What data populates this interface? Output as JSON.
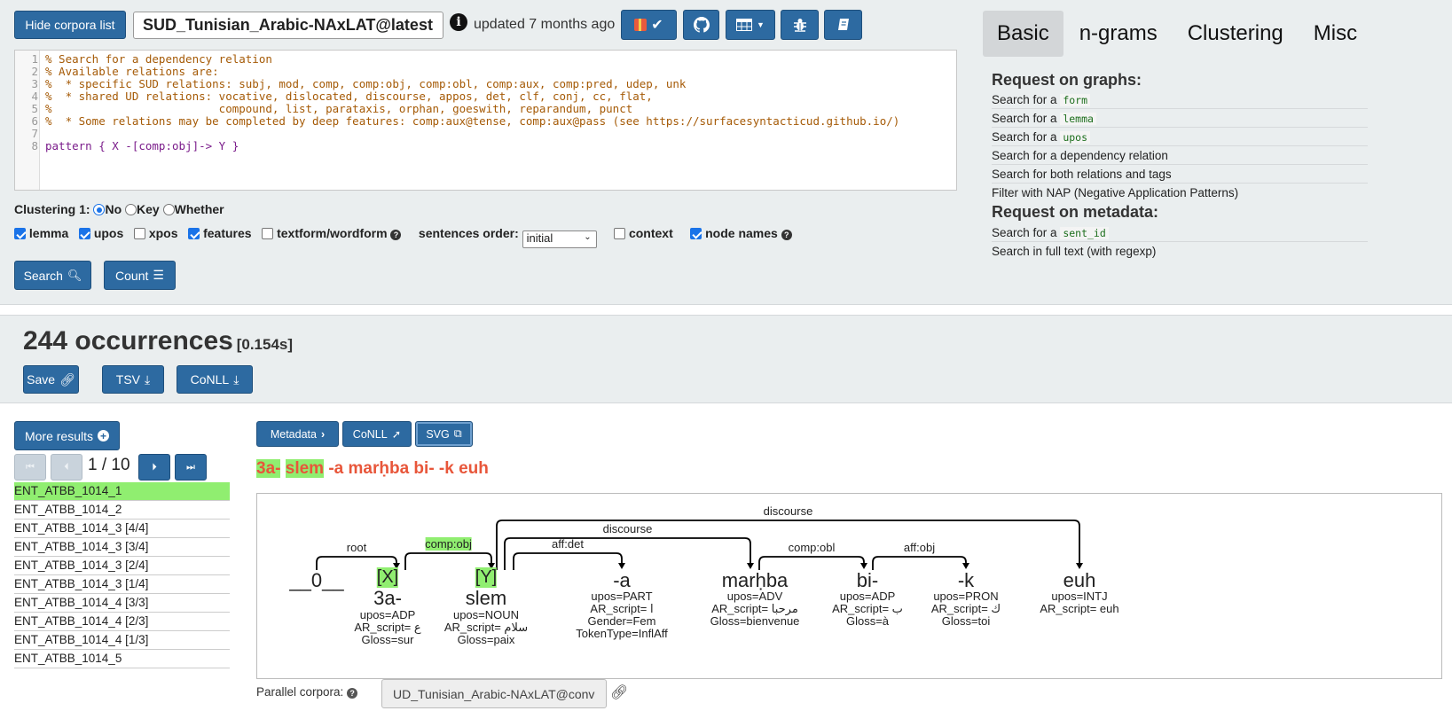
{
  "header": {
    "hide_corpora_label": "Hide corpora list",
    "corpus_name": "SUD_Tunisian_Arabic-NAxLAT@latest",
    "info_icon": "info-icon",
    "updated_text": "updated 7 months ago",
    "icons": [
      "gift-check-icon",
      "github-icon",
      "table-icon",
      "bug-icon",
      "book-icon"
    ]
  },
  "editor": {
    "lines": [
      {
        "n": "1",
        "text": "% Search for a dependency relation",
        "type": "comment"
      },
      {
        "n": "2",
        "text": "% Available relations are:",
        "type": "comment"
      },
      {
        "n": "3",
        "text": "%  * specific SUD relations: subj, mod, comp, comp:obj, comp:obl, comp:aux, comp:pred, udep, unk",
        "type": "comment"
      },
      {
        "n": "4",
        "text": "%  * shared UD relations: vocative, dislocated, discourse, appos, det, clf, conj, cc, flat,",
        "type": "comment"
      },
      {
        "n": "5",
        "text": "%                         compound, list, parataxis, orphan, goeswith, reparandum, punct",
        "type": "comment"
      },
      {
        "n": "6",
        "text": "%  * Some relations may be completed by deep features: comp:aux@tense, comp:aux@pass (see https://surfacesyntacticud.github.io/)",
        "type": "comment"
      },
      {
        "n": "7",
        "text": "",
        "type": "blank"
      },
      {
        "n": "8",
        "text": "pattern { X -[comp:obj]-> Y }",
        "type": "code"
      }
    ]
  },
  "clustering": {
    "label": "Clustering 1:",
    "options": [
      "No",
      "Key",
      "Whether"
    ],
    "selected": "No"
  },
  "display_options": {
    "lemma": "lemma",
    "upos": "upos",
    "xpos": "xpos",
    "features": "features",
    "textform": "textform/wordform",
    "sentences_order_label": "sentences order:",
    "sentences_order_value": "initial",
    "context": "context",
    "node_names": "node names"
  },
  "actions": {
    "search": "Search",
    "count": "Count"
  },
  "tabs": [
    "Basic",
    "n-grams",
    "Clustering",
    "Misc"
  ],
  "sidebar": {
    "graphs_heading": "Request on graphs:",
    "graph_links": [
      {
        "text": "Search for a",
        "code": "form"
      },
      {
        "text": "Search for a",
        "code": "lemma"
      },
      {
        "text": "Search for a",
        "code": "upos"
      },
      {
        "text": "Search for a dependency relation",
        "code": ""
      },
      {
        "text": "Search for both relations and tags",
        "code": ""
      },
      {
        "text": "Filter with NAP (Negative Application Patterns)",
        "code": ""
      }
    ],
    "metadata_heading": "Request on metadata:",
    "metadata_links": [
      {
        "text": "Search for a",
        "code": "sent_id"
      },
      {
        "text": "Search in full text (with regexp)",
        "code": ""
      }
    ]
  },
  "results": {
    "count": "244 occurrences",
    "time": "[0.154s]",
    "save": "Save",
    "tsv": "TSV",
    "conll": "CoNLL"
  },
  "navigation": {
    "more_results": "More results",
    "page": "1 / 10"
  },
  "sentences": [
    "ENT_ATBB_1014_1",
    "ENT_ATBB_1014_2",
    "ENT_ATBB_1014_3 [4/4]",
    "ENT_ATBB_1014_3 [3/4]",
    "ENT_ATBB_1014_3 [2/4]",
    "ENT_ATBB_1014_3 [1/4]",
    "ENT_ATBB_1014_4 [3/3]",
    "ENT_ATBB_1014_4 [2/3]",
    "ENT_ATBB_1014_4 [1/3]",
    "ENT_ATBB_1014_5"
  ],
  "viewer": {
    "metadata_btn": "Metadata",
    "conll_btn": "CoNLL",
    "svg_btn": "SVG",
    "sentence_hl1": "3a-",
    "sentence_hl2": "slem",
    "sentence_rest": "-a marḥba bi- -k euh"
  },
  "graph": {
    "root_token": "__0__",
    "tokens": [
      {
        "form": "3a-",
        "node": "[X]",
        "feats": [
          "upos=ADP",
          "AR_script= ع",
          "Gloss=sur"
        ]
      },
      {
        "form": "slem",
        "node": "[Y]",
        "feats": [
          "upos=NOUN",
          "AR_script= سلام",
          "Gloss=paix"
        ]
      },
      {
        "form": "-a",
        "node": "",
        "feats": [
          "upos=PART",
          "AR_script= ا",
          "Gender=Fem",
          "TokenType=InflAff"
        ]
      },
      {
        "form": "marḥba",
        "node": "",
        "feats": [
          "upos=ADV",
          "AR_script= مرحبا",
          "Gloss=bienvenue"
        ]
      },
      {
        "form": "bi-",
        "node": "",
        "feats": [
          "upos=ADP",
          "AR_script= ب",
          "Gloss=à"
        ]
      },
      {
        "form": "-k",
        "node": "",
        "feats": [
          "upos=PRON",
          "AR_script= ك",
          "Gloss=toi"
        ]
      },
      {
        "form": "euh",
        "node": "",
        "feats": [
          "upos=INTJ",
          "AR_script= euh"
        ]
      }
    ],
    "relations": [
      "root",
      "comp:obj",
      "aff:det",
      "discourse",
      "discourse",
      "comp:obl",
      "aff:obj"
    ]
  },
  "parallel": {
    "label": "Parallel corpora:",
    "value": "UD_Tunisian_Arabic-NAxLAT@conv"
  }
}
